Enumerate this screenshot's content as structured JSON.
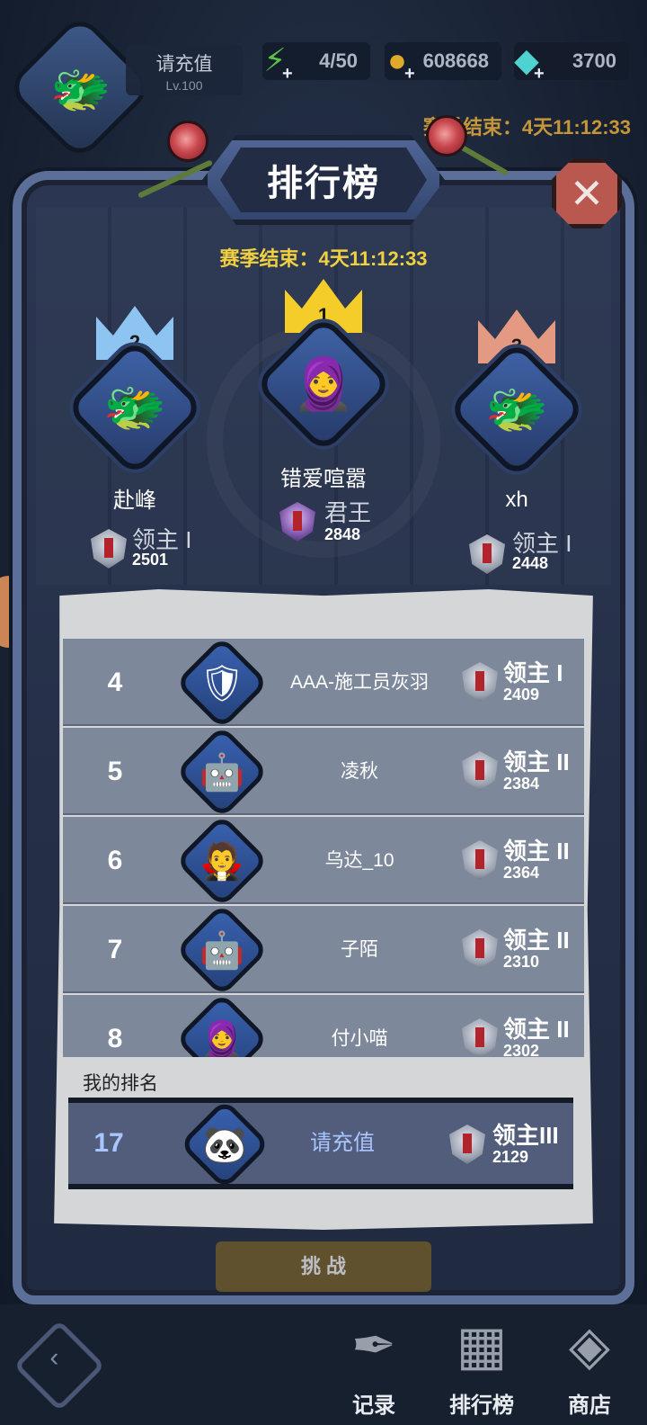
{
  "hud": {
    "player_name": "请充值",
    "level": "Lv.100",
    "energy": "4/50",
    "gold": "608668",
    "gems": "3700",
    "plus": "+",
    "timer": "赛季结束：4天11:12:33"
  },
  "title": "排行榜",
  "close": "✕",
  "season_timer": "赛季结束：4天11:12:33",
  "podium": [
    {
      "rank": "2",
      "name": "赴峰",
      "tier": "领主 I",
      "score": "2501",
      "crown_color": "#8ec4f2"
    },
    {
      "rank": "1",
      "name": "错爱喧嚣",
      "tier": "君王",
      "score": "2848",
      "crown_color": "#f4cd2b"
    },
    {
      "rank": "3",
      "name": "xh",
      "tier": "领主 I",
      "score": "2448",
      "crown_color": "#e49a82"
    }
  ],
  "list": [
    {
      "rank": "4",
      "name": "AAA-施工员灰羽",
      "tier": "领主 I",
      "score": "2409",
      "icon": "knight-avatar"
    },
    {
      "rank": "5",
      "name": "凌秋",
      "tier": "领主 II",
      "score": "2384",
      "icon": "robot-avatar"
    },
    {
      "rank": "6",
      "name": "乌达_10",
      "tier": "领主 II",
      "score": "2364",
      "icon": "witch-avatar"
    },
    {
      "rank": "7",
      "name": "子陌",
      "tier": "领主 II",
      "score": "2310",
      "icon": "robot-avatar"
    },
    {
      "rank": "8",
      "name": "付小喵",
      "tier": "领主 II",
      "score": "2302",
      "icon": "nun-avatar"
    }
  ],
  "my_rank_label": "我的排名",
  "my_rank": {
    "rank": "17",
    "name": "请充值",
    "tier": "领主III",
    "score": "2129",
    "icon": "panda-avatar"
  },
  "challenge_button": "挑 战",
  "nav": [
    {
      "label": "记录",
      "icon": "quill-icon"
    },
    {
      "label": "排行榜",
      "icon": "leaderboard-icon"
    },
    {
      "label": "商店",
      "icon": "shop-icon"
    }
  ],
  "colors": {
    "gold_text": "#f0d040",
    "panel": "#d5d6d8",
    "row": "#7e889b",
    "my_row": "#515d7a"
  }
}
